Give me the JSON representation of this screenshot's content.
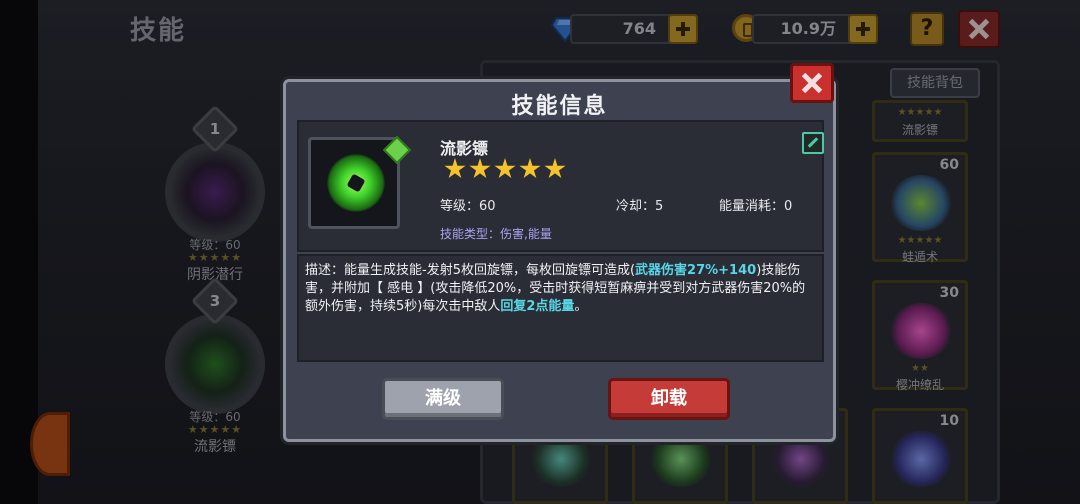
{
  "screen": {
    "title": "技能"
  },
  "resources": {
    "gems": "764",
    "gold": "10.9万"
  },
  "background_slots": [
    {
      "number": "1",
      "level": "等级：60",
      "stars": "★★★★★",
      "name": "阴影潜行"
    },
    {
      "number": "3",
      "level": "等级：60",
      "stars": "★★★★★",
      "name": "流影镖"
    }
  ],
  "grid": {
    "bag_label": "技能背包",
    "cards": [
      {
        "level": "",
        "stars": "★★★★★",
        "name": "流影镖"
      },
      {
        "level": "60",
        "stars": "★★★★★",
        "name": "蛙遁术"
      },
      {
        "level": "30",
        "stars": "★★",
        "name": "樱冲缭乱"
      },
      {
        "level": "10",
        "stars": "",
        "name": ""
      }
    ]
  },
  "modal": {
    "title": "技能信息",
    "skill_name": "流影镖",
    "star_count": 5,
    "level_label": "等级：60",
    "cooldown_label": "冷却：5",
    "energy_label": "能量消耗：0",
    "type_label": "技能类型：伤害,能量",
    "description": {
      "p1": "描述：能量生成技能-发射5枚回旋镖，每枚回旋镖可造成(",
      "h1": "武器伤害27%+140",
      "p2": ")技能伤害，并附加【 感电 】(攻击降低20%，受击时获得短暂麻痹并受到对方武器伤害20%的额外伤害，持续5秒)每次击中敌人",
      "h2": "回复2点能量",
      "p3": "。"
    },
    "max_button": "满级",
    "unload_button": "卸载"
  }
}
